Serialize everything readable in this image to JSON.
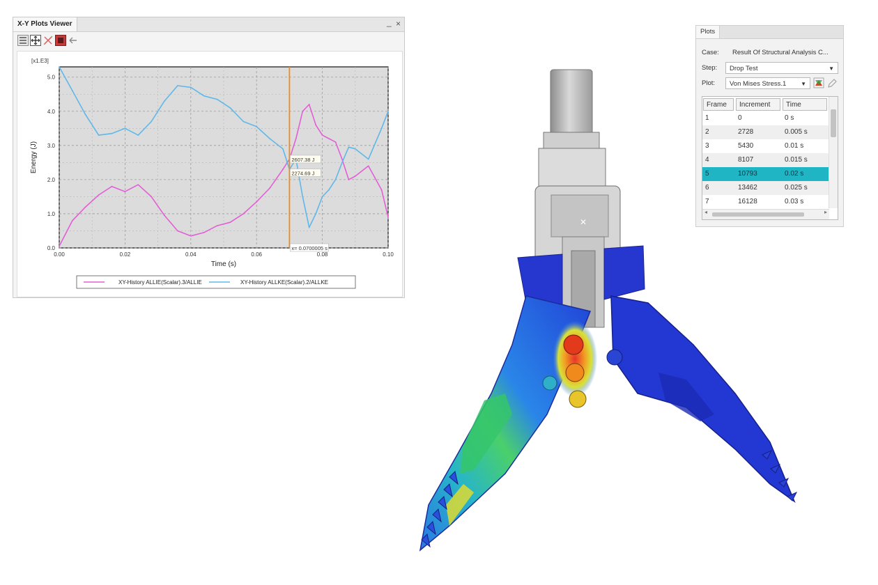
{
  "xy_viewer": {
    "title": "X-Y Plots Viewer",
    "minimize_glyph": "_",
    "close_glyph": "×",
    "toolbar_icons": [
      "legend-icon",
      "fit-all-icon",
      "delete-curve-icon",
      "remove-icon",
      "back-arrow-icon"
    ],
    "curve_labels": [
      "2607.38 J",
      "2274.69 J"
    ],
    "cursor_label": "x= 0.0700005 s"
  },
  "chart_data": {
    "type": "line",
    "scale_label": "[x1.E3]",
    "xlabel": "Time (s)",
    "ylabel": "Energy (J)",
    "xlim": [
      0,
      0.1
    ],
    "ylim": [
      0,
      5.3
    ],
    "x_ticks": [
      "0.00",
      "0.02",
      "0.04",
      "0.06",
      "0.08",
      "0.10"
    ],
    "y_ticks": [
      "0.0",
      "1.0",
      "2.0",
      "3.0",
      "4.0",
      "5.0"
    ],
    "cursor_x": 0.0700005,
    "grid": true,
    "legend_position": "bottom",
    "series": [
      {
        "name": "XY-History ALLIE(Scalar).3/ALLIE",
        "color": "#e25fd5",
        "x": [
          0.0,
          0.004,
          0.008,
          0.012,
          0.016,
          0.02,
          0.024,
          0.028,
          0.032,
          0.036,
          0.04,
          0.044,
          0.048,
          0.052,
          0.056,
          0.06,
          0.064,
          0.068,
          0.07,
          0.072,
          0.074,
          0.076,
          0.078,
          0.08,
          0.082,
          0.084,
          0.086,
          0.088,
          0.09,
          0.094,
          0.098,
          0.1
        ],
        "y": [
          0.05,
          0.8,
          1.2,
          1.55,
          1.8,
          1.65,
          1.85,
          1.5,
          0.95,
          0.5,
          0.35,
          0.45,
          0.65,
          0.75,
          1.0,
          1.35,
          1.75,
          2.3,
          2.6,
          3.2,
          4.0,
          4.2,
          3.6,
          3.3,
          3.2,
          3.1,
          2.6,
          2.0,
          2.1,
          2.4,
          1.7,
          0.9
        ]
      },
      {
        "name": "XY-History ALLKE(Scalar).2/ALLKE",
        "color": "#5fb8e8",
        "x": [
          0.0,
          0.004,
          0.008,
          0.012,
          0.016,
          0.02,
          0.024,
          0.028,
          0.032,
          0.036,
          0.04,
          0.044,
          0.048,
          0.052,
          0.056,
          0.06,
          0.064,
          0.068,
          0.07,
          0.072,
          0.074,
          0.076,
          0.078,
          0.08,
          0.082,
          0.084,
          0.086,
          0.088,
          0.09,
          0.094,
          0.098,
          0.1
        ],
        "y": [
          5.3,
          4.6,
          3.9,
          3.3,
          3.35,
          3.5,
          3.3,
          3.7,
          4.3,
          4.75,
          4.7,
          4.45,
          4.35,
          4.1,
          3.7,
          3.55,
          3.2,
          2.9,
          2.3,
          2.6,
          1.5,
          0.6,
          1.0,
          1.5,
          1.7,
          2.0,
          2.5,
          2.95,
          2.9,
          2.6,
          3.5,
          4.0
        ]
      }
    ]
  },
  "plots_panel": {
    "tab": "Plots",
    "case_label": "Case:",
    "case_value": "Result Of Structural Analysis C...",
    "step_label": "Step:",
    "step_value": "Drop Test",
    "plot_label": "Plot:",
    "plot_value": "Von Mises Stress.1",
    "columns": [
      "Frame",
      "Increment",
      "Time"
    ],
    "rows": [
      {
        "frame": "1",
        "increment": "0",
        "time": "0 s"
      },
      {
        "frame": "2",
        "increment": "2728",
        "time": "0.005 s"
      },
      {
        "frame": "3",
        "increment": "5430",
        "time": "0.01 s"
      },
      {
        "frame": "4",
        "increment": "8107",
        "time": "0.015 s"
      },
      {
        "frame": "5",
        "increment": "10793",
        "time": "0.02 s"
      },
      {
        "frame": "6",
        "increment": "13462",
        "time": "0.025 s"
      },
      {
        "frame": "7",
        "increment": "16128",
        "time": "0.03 s"
      }
    ],
    "selected_frame": "5"
  },
  "colors": {
    "accent_selection": "#1fb5c5",
    "stress_low": "#1c2fd6",
    "stress_high": "#e23a1a",
    "cursor_line": "#f08a1c"
  }
}
